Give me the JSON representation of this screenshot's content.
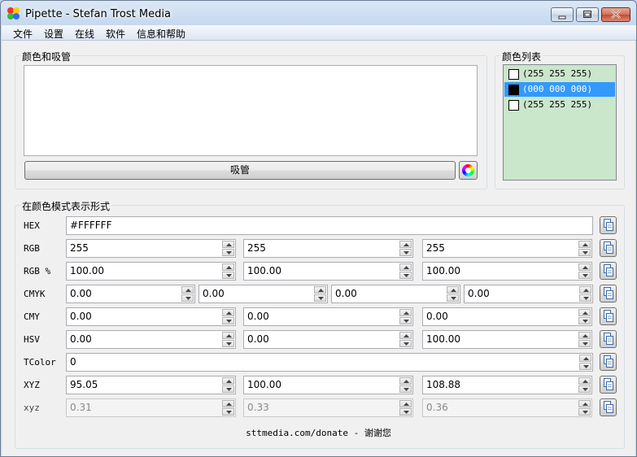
{
  "window": {
    "title": "Pipette - Stefan Trost Media"
  },
  "menu": [
    "文件",
    "设置",
    "在线",
    "软件",
    "信息和帮助"
  ],
  "picker": {
    "group_title": "颜色和吸管",
    "pick_button": "吸管"
  },
  "color_list": {
    "group_title": "颜色列表",
    "items": [
      {
        "label": "(255 255 255)",
        "color": "#ffffff",
        "selected": false
      },
      {
        "label": "(000 000 000)",
        "color": "#000000",
        "selected": true
      },
      {
        "label": "(255 255 255)",
        "color": "#ffffff",
        "selected": false
      }
    ]
  },
  "models": {
    "group_title": "在颜色模式表示形式",
    "rows": [
      {
        "label": "HEX",
        "values": [
          "#FFFFFF"
        ],
        "spinner": false,
        "disabled": false
      },
      {
        "label": "RGB",
        "values": [
          "255",
          "255",
          "255"
        ],
        "spinner": true,
        "disabled": false
      },
      {
        "label": "RGB %",
        "values": [
          "100.00",
          "100.00",
          "100.00"
        ],
        "spinner": true,
        "disabled": false
      },
      {
        "label": "CMYK",
        "values": [
          "0.00",
          "0.00",
          "0.00",
          "0.00"
        ],
        "spinner": true,
        "disabled": false
      },
      {
        "label": "CMY",
        "values": [
          "0.00",
          "0.00",
          "0.00"
        ],
        "spinner": true,
        "disabled": false
      },
      {
        "label": "HSV",
        "values": [
          "0.00",
          "0.00",
          "100.00"
        ],
        "spinner": true,
        "disabled": false
      },
      {
        "label": "TColor",
        "values": [
          "0"
        ],
        "spinner": true,
        "disabled": false
      },
      {
        "label": "XYZ",
        "values": [
          "95.05",
          "100.00",
          "108.88"
        ],
        "spinner": true,
        "disabled": false
      },
      {
        "label": "xyz",
        "values": [
          "0.31",
          "0.33",
          "0.36"
        ],
        "spinner": true,
        "disabled": true
      }
    ]
  },
  "footer": "sttmedia.com/donate - 谢谢您",
  "colors": {
    "selection": "#3399ff",
    "list_background": "#cae6cb"
  }
}
